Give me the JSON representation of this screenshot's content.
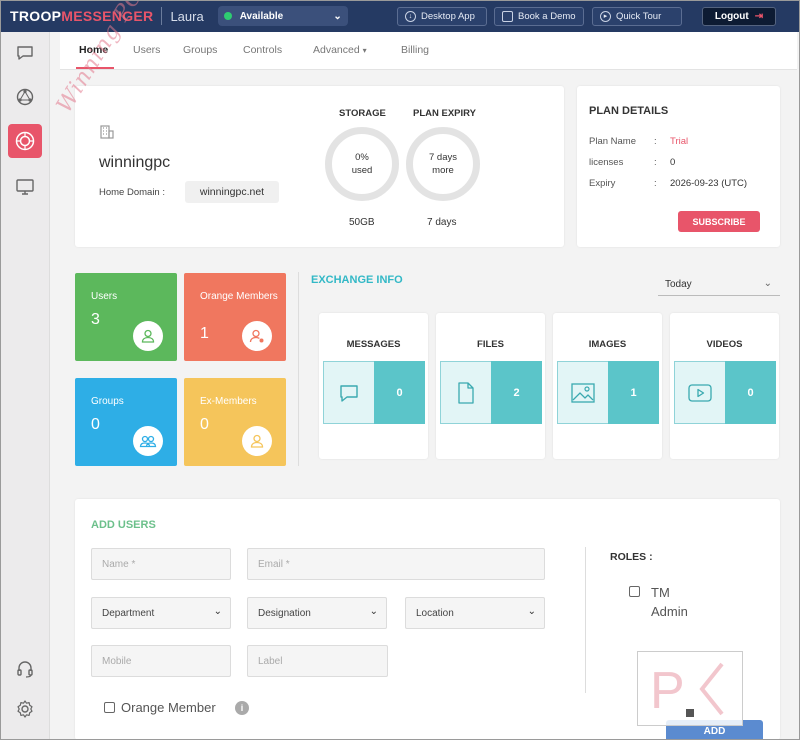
{
  "topbar": {
    "brand_troop": "TROOP",
    "brand_messenger": "MESSENGER",
    "user_name": "Laura",
    "status": "Available",
    "buttons": {
      "desktop_app": "Desktop App",
      "book_demo": "Book a Demo",
      "quick_tour": "Quick Tour",
      "logout": "Logout"
    }
  },
  "sidebar": {
    "items": [
      {
        "name": "chat-bubble-icon"
      },
      {
        "name": "network-icon"
      },
      {
        "name": "admin-dashboard-icon",
        "active": true
      },
      {
        "name": "monitor-icon"
      },
      {
        "name": "headset-icon"
      },
      {
        "name": "settings-gear-icon"
      }
    ]
  },
  "nav": {
    "tabs": [
      "Home",
      "Users",
      "Groups",
      "Controls",
      "Advanced",
      "Billing"
    ],
    "active": "Home"
  },
  "org": {
    "name": "winningpc",
    "domain_label": "Home Domain :",
    "domain": "winningpc.net"
  },
  "usage": {
    "storage_title": "STORAGE",
    "storage_used_value": "0%",
    "storage_used_text": "used",
    "storage_total": "50GB",
    "expiry_title": "PLAN EXPIRY",
    "expiry_value": "7 days",
    "expiry_text": "more",
    "expiry_foot": "7 days"
  },
  "plan": {
    "title": "PLAN DETAILS",
    "rows": [
      {
        "key": "Plan Name",
        "value": "Trial"
      },
      {
        "key": "licenses",
        "value": "0"
      },
      {
        "key": "Expiry",
        "value": "2026-09-23 (UTC)"
      }
    ],
    "subscribe": "SUBSCRIBE"
  },
  "tiles": [
    {
      "label": "Users",
      "value": "3",
      "color": "#5cb85c"
    },
    {
      "label": "Orange Members",
      "value": "1",
      "color": "#f0775f"
    },
    {
      "label": "Groups",
      "value": "0",
      "color": "#2eaee6"
    },
    {
      "label": "Ex-Members",
      "value": "0",
      "color": "#f5c55b"
    }
  ],
  "exchange": {
    "title": "EXCHANGE INFO",
    "period": "Today",
    "items": [
      {
        "label": "MESSAGES",
        "count": "0"
      },
      {
        "label": "FILES",
        "count": "2"
      },
      {
        "label": "IMAGES",
        "count": "1"
      },
      {
        "label": "VIDEOS",
        "count": "0"
      }
    ]
  },
  "add_users": {
    "title": "ADD USERS",
    "name_placeholder": "Name *",
    "email_placeholder": "Email *",
    "department": "Department",
    "designation": "Designation",
    "location": "Location",
    "mobile_placeholder": "Mobile",
    "label_placeholder": "Label",
    "orange_member": "Orange Member",
    "roles_title": "ROLES :",
    "role_tm": "TM",
    "role_admin": "Admin",
    "add_button": "ADD"
  },
  "watermark": {
    "text": "Winning PC",
    "logo": "PC"
  },
  "colors": {
    "topbar": "#253a63",
    "accent": "#e8556a",
    "teal": "#5bc5c9",
    "green_title": "#6cc08b",
    "add_button": "#5b8bd0"
  }
}
